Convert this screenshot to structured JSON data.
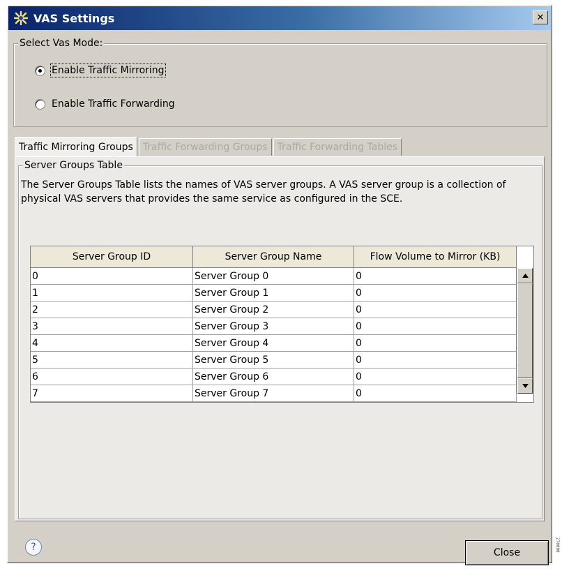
{
  "window": {
    "title": "VAS Settings",
    "close_glyph": "✕"
  },
  "mode_group": {
    "legend": "Select Vas Mode:",
    "options": [
      {
        "label": "Enable Traffic Mirroring",
        "checked": true
      },
      {
        "label": "Enable Traffic Forwarding",
        "checked": false
      }
    ]
  },
  "tabs": [
    {
      "label": "Traffic Mirroring Groups",
      "active": true,
      "enabled": true
    },
    {
      "label": "Traffic Forwarding Groups",
      "active": false,
      "enabled": false
    },
    {
      "label": "Traffic Forwarding Tables",
      "active": false,
      "enabled": false
    }
  ],
  "server_groups": {
    "legend": "Server Groups Table",
    "description": "The Server Groups Table lists the names of VAS server groups. A VAS server group is a collection of physical VAS servers that provides the same service as configured in the SCE.",
    "columns": [
      "Server Group ID",
      "Server Group Name",
      "Flow Volume to Mirror (KB)"
    ],
    "rows": [
      [
        "0",
        "Server Group 0",
        "0"
      ],
      [
        "1",
        "Server Group 1",
        "0"
      ],
      [
        "2",
        "Server Group 2",
        "0"
      ],
      [
        "3",
        "Server Group 3",
        "0"
      ],
      [
        "4",
        "Server Group 4",
        "0"
      ],
      [
        "5",
        "Server Group 5",
        "0"
      ],
      [
        "6",
        "Server Group 6",
        "0"
      ],
      [
        "7",
        "Server Group 7",
        "0"
      ]
    ]
  },
  "footer": {
    "help_glyph": "?",
    "close_label": "Close"
  },
  "side_stamp": "270000",
  "icons": [
    "app-icon",
    "window-close-icon",
    "help-icon",
    "scroll-up-icon",
    "scroll-down-icon"
  ],
  "colors": {
    "title_start": "#0a246a",
    "title_end": "#a6caf0",
    "dialog_bg": "#d4d0c8",
    "disabled_text": "#a8a8a8"
  }
}
